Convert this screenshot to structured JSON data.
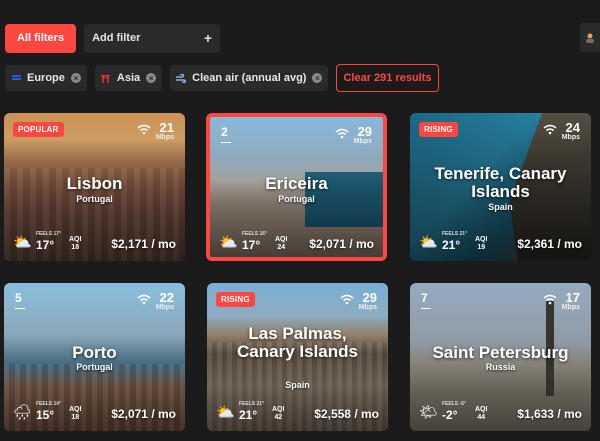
{
  "toolbar": {
    "all_filters": "All filters",
    "add_filter": "Add filter",
    "add_icon": "+"
  },
  "filters": [
    {
      "label": "Europe",
      "icon": "europe-flag-icon",
      "color": "#2b5bd7"
    },
    {
      "label": "Asia",
      "icon": "asia-gate-icon",
      "color": "#e3362e"
    },
    {
      "label": "Clean air (annual avg)",
      "icon": "wind-icon",
      "color": "#9ec5ff"
    }
  ],
  "clear_label": "Clear 291 results",
  "cards": [
    {
      "tag": "POPULAR",
      "rank": "",
      "wifi": "21",
      "wifi_unit": "Mbps",
      "name": "Lisbon",
      "country": "Portugal",
      "feels": "FEELS 17°",
      "temp": "17°",
      "aqi_label": "AQI",
      "aqi": "18",
      "price": "$2,171 / mo",
      "weather": "partly-cloudy-icon"
    },
    {
      "tag": "",
      "rank": "2",
      "wifi": "29",
      "wifi_unit": "Mbps",
      "name": "Ericeira",
      "country": "Portugal",
      "feels": "FEELS 16°",
      "temp": "17°",
      "aqi_label": "AQI",
      "aqi": "24",
      "price": "$2,071 / mo",
      "weather": "partly-cloudy-icon"
    },
    {
      "tag": "RISING",
      "rank": "",
      "wifi": "24",
      "wifi_unit": "Mbps",
      "name": "Tenerife, Canary Islands",
      "country": "Spain",
      "feels": "FEELS 21°",
      "temp": "21°",
      "aqi_label": "AQI",
      "aqi": "19",
      "price": "$2,361 / mo",
      "weather": "partly-cloudy-icon"
    },
    {
      "tag": "",
      "rank": "5",
      "wifi": "22",
      "wifi_unit": "Mbps",
      "name": "Porto",
      "country": "Portugal",
      "feels": "FEELS 14°",
      "temp": "15°",
      "aqi_label": "AQI",
      "aqi": "18",
      "price": "$2,071 / mo",
      "weather": "rain-cloud-icon"
    },
    {
      "tag": "RISING",
      "rank": "",
      "wifi": "29",
      "wifi_unit": "Mbps",
      "name": "Las Palmas, Canary Islands",
      "country": "Spain",
      "feels": "FEELS 21°",
      "temp": "21°",
      "aqi_label": "AQI",
      "aqi": "42",
      "price": "$2,558 / mo",
      "weather": "partly-cloudy-icon"
    },
    {
      "tag": "",
      "rank": "7",
      "wifi": "17",
      "wifi_unit": "Mbps",
      "name": "Saint Petersburg",
      "country": "Russia",
      "feels": "FEELS -5°",
      "temp": "-2°",
      "aqi_label": "AQI",
      "aqi": "44",
      "price": "$1,633 / mo",
      "weather": "partly-sunny-icon"
    }
  ]
}
